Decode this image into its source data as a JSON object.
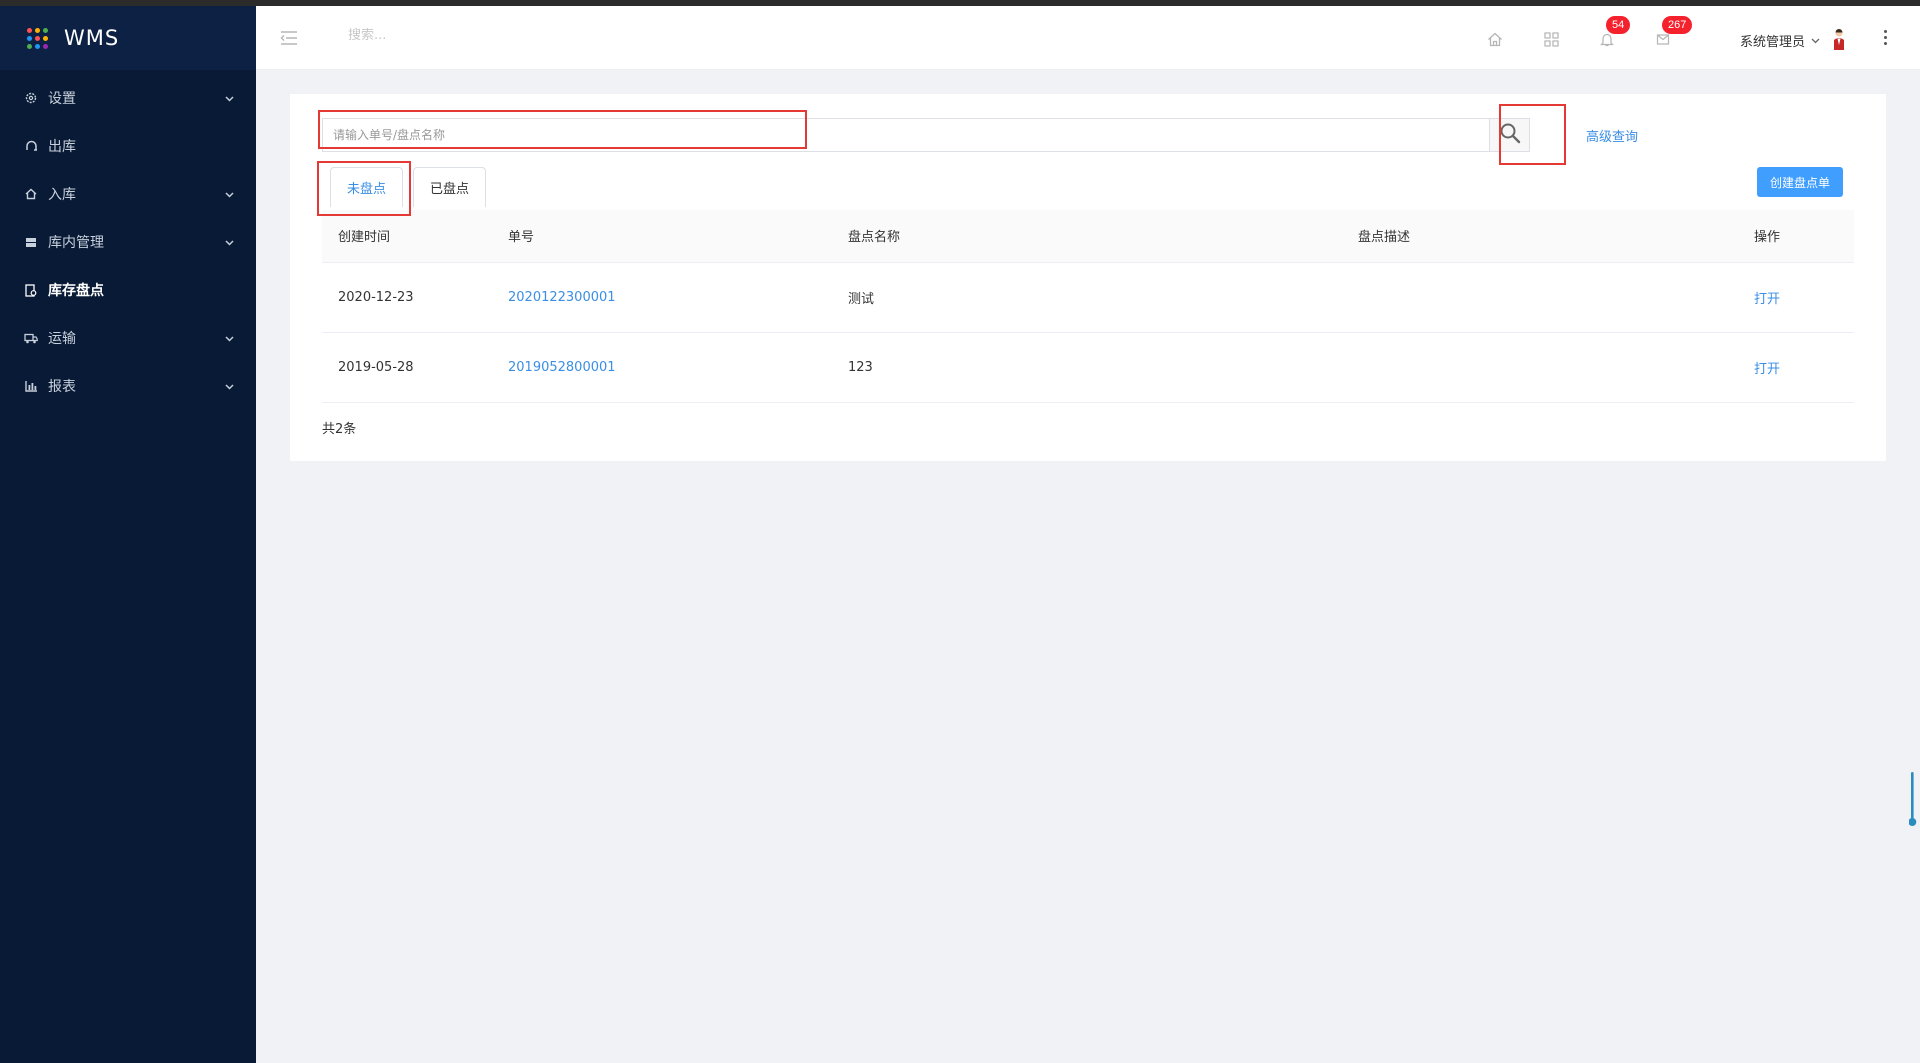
{
  "app": {
    "title": "WMS"
  },
  "logo_colors": [
    "#ff5252",
    "#ffb300",
    "#4caf50",
    "#2196f3",
    "#ff5252",
    "#ffb300",
    "#4caf50",
    "#2196f3",
    "#9c27b0"
  ],
  "sidebar": {
    "items": [
      {
        "label": "设置",
        "icon": "gear-icon",
        "has_children": true,
        "active": false
      },
      {
        "label": "出库",
        "icon": "export-icon",
        "has_children": false,
        "active": false
      },
      {
        "label": "入库",
        "icon": "import-icon",
        "has_children": true,
        "active": false
      },
      {
        "label": "库内管理",
        "icon": "box-icon",
        "has_children": true,
        "active": false
      },
      {
        "label": "库存盘点",
        "icon": "inventory-icon",
        "has_children": false,
        "active": true
      },
      {
        "label": "运输",
        "icon": "truck-icon",
        "has_children": true,
        "active": false
      },
      {
        "label": "报表",
        "icon": "chart-icon",
        "has_children": true,
        "active": false
      }
    ]
  },
  "header": {
    "search_placeholder": "搜索...",
    "notification_count": "54",
    "message_count": "267",
    "user_name": "系统管理员"
  },
  "main": {
    "search_placeholder": "请输入单号/盘点名称",
    "advanced_search_label": "高级查询",
    "create_button_label": "创建盘点单",
    "tabs": [
      {
        "label": "未盘点",
        "active": true
      },
      {
        "label": "已盘点",
        "active": false
      }
    ],
    "table": {
      "columns": [
        "创建时间",
        "单号",
        "盘点名称",
        "盘点描述",
        "操作"
      ],
      "rows": [
        {
          "created": "2020-12-23",
          "number": "2020122300001",
          "name": "测试",
          "description": "",
          "action": "打开"
        },
        {
          "created": "2019-05-28",
          "number": "2019052800001",
          "name": "123",
          "description": "",
          "action": "打开"
        }
      ]
    },
    "total_label": "共2条"
  },
  "colors": {
    "sidebar_bg": "#081a35",
    "accent": "#409eff",
    "link": "#3a8ee6",
    "badge": "#f5222d",
    "highlight": "#e53935"
  }
}
